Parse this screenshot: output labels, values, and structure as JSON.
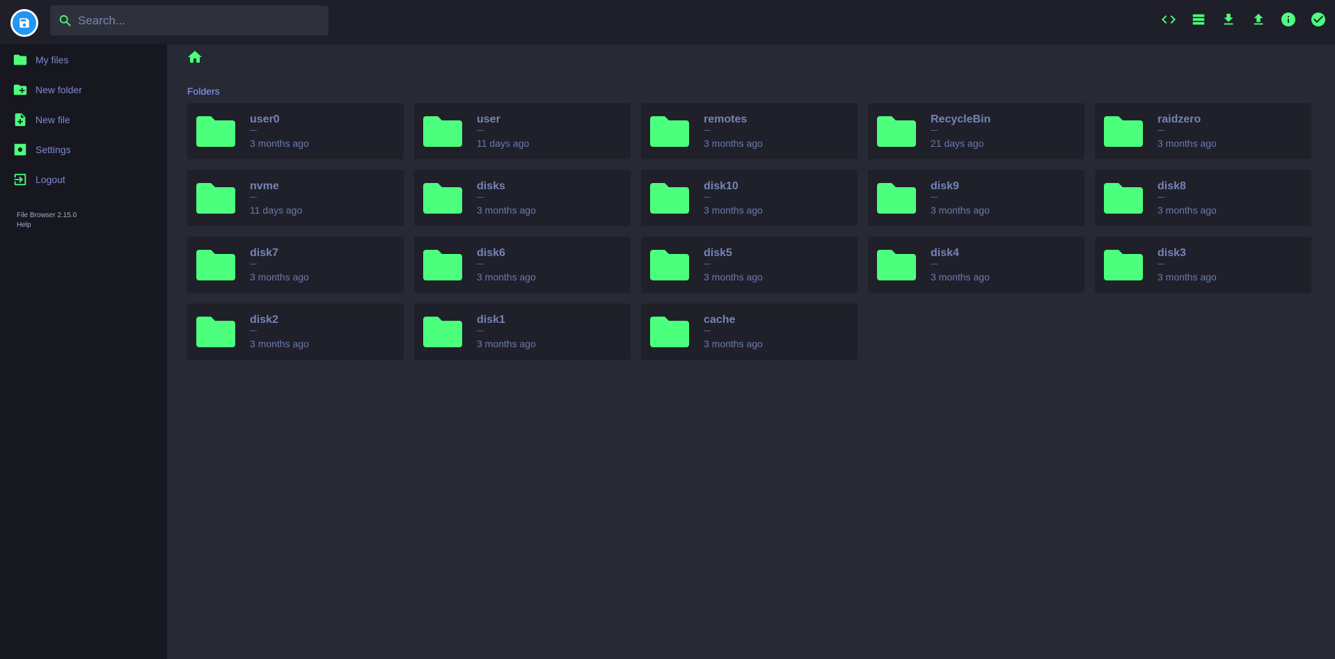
{
  "search": {
    "placeholder": "Search..."
  },
  "header": {
    "actions": [
      "code-icon",
      "list-view-icon",
      "download-icon",
      "upload-icon",
      "info-icon",
      "check-circle-icon"
    ]
  },
  "sidebar": {
    "items": [
      {
        "label": "My files",
        "icon": "folder-icon"
      },
      {
        "label": "New folder",
        "icon": "new-folder-icon"
      },
      {
        "label": "New file",
        "icon": "new-file-icon"
      },
      {
        "label": "Settings",
        "icon": "settings-icon"
      },
      {
        "label": "Logout",
        "icon": "logout-icon"
      }
    ],
    "credits": {
      "version": "File Browser 2.15.0",
      "help": "Help"
    }
  },
  "main": {
    "section_title": "Folders",
    "folders": [
      {
        "name": "user0",
        "size": "—",
        "modified": "3 months ago"
      },
      {
        "name": "user",
        "size": "—",
        "modified": "11 days ago"
      },
      {
        "name": "remotes",
        "size": "—",
        "modified": "3 months ago"
      },
      {
        "name": "RecycleBin",
        "size": "—",
        "modified": "21 days ago"
      },
      {
        "name": "raidzero",
        "size": "—",
        "modified": "3 months ago"
      },
      {
        "name": "nvme",
        "size": "—",
        "modified": "11 days ago"
      },
      {
        "name": "disks",
        "size": "—",
        "modified": "3 months ago"
      },
      {
        "name": "disk10",
        "size": "—",
        "modified": "3 months ago"
      },
      {
        "name": "disk9",
        "size": "—",
        "modified": "3 months ago"
      },
      {
        "name": "disk8",
        "size": "—",
        "modified": "3 months ago"
      },
      {
        "name": "disk7",
        "size": "—",
        "modified": "3 months ago"
      },
      {
        "name": "disk6",
        "size": "—",
        "modified": "3 months ago"
      },
      {
        "name": "disk5",
        "size": "—",
        "modified": "3 months ago"
      },
      {
        "name": "disk4",
        "size": "—",
        "modified": "3 months ago"
      },
      {
        "name": "disk3",
        "size": "—",
        "modified": "3 months ago"
      },
      {
        "name": "disk2",
        "size": "—",
        "modified": "3 months ago"
      },
      {
        "name": "disk1",
        "size": "—",
        "modified": "3 months ago"
      },
      {
        "name": "cache",
        "size": "—",
        "modified": "3 months ago"
      }
    ]
  },
  "colors": {
    "accent": "#4cff7d",
    "background": "#272935",
    "header": "#1e1f29",
    "sidebar": "#16171f",
    "card": "#1f2029"
  }
}
